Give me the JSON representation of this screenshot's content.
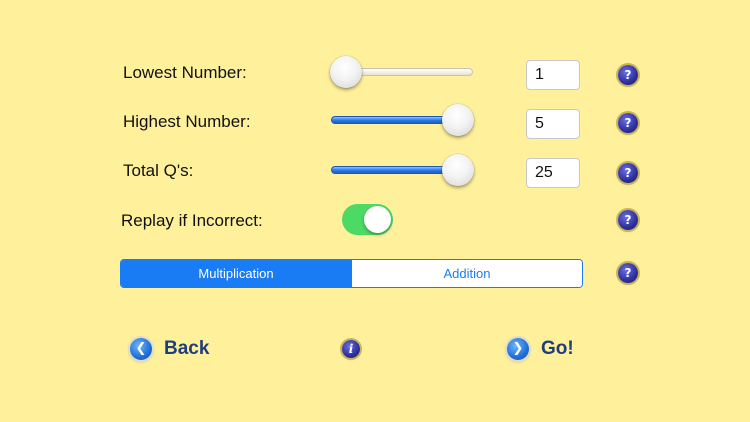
{
  "settings": {
    "lowest": {
      "label": "Lowest Number:",
      "value": "1",
      "slider_level": 0.0
    },
    "highest": {
      "label": "Highest Number:",
      "value": "5",
      "slider_level": 1.0
    },
    "total": {
      "label": "Total Q's:",
      "value": "25",
      "slider_level": 1.0
    },
    "replay": {
      "label": "Replay if Incorrect:",
      "on": true
    }
  },
  "mode": {
    "options": [
      "Multiplication",
      "Addition"
    ],
    "selected": "Multiplication"
  },
  "help_icon": "?",
  "info_icon": "i",
  "nav": {
    "back_label": "Back",
    "go_label": "Go!"
  },
  "colors": {
    "background": "#fff09c",
    "accent": "#1a7cf5",
    "toggle_on": "#4cd964",
    "nav_text": "#1f3f7a"
  }
}
